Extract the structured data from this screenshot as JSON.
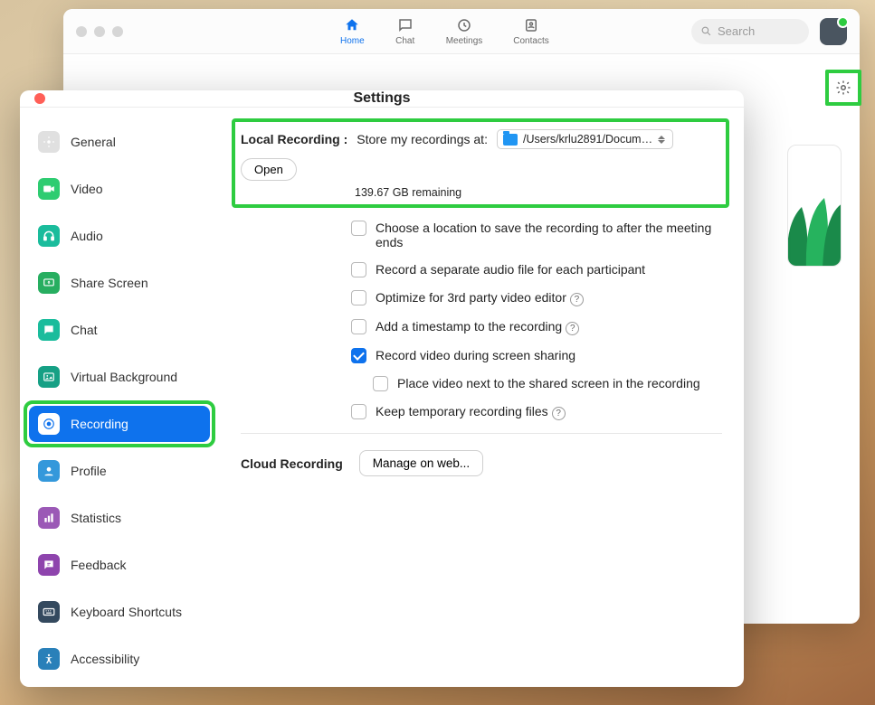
{
  "main": {
    "nav": {
      "home": "Home",
      "chat": "Chat",
      "meetings": "Meetings",
      "contacts": "Contacts"
    },
    "search_placeholder": "Search"
  },
  "settings": {
    "title": "Settings",
    "sidebar": [
      "General",
      "Video",
      "Audio",
      "Share Screen",
      "Chat",
      "Virtual Background",
      "Recording",
      "Profile",
      "Statistics",
      "Feedback",
      "Keyboard Shortcuts",
      "Accessibility"
    ],
    "local": {
      "label": "Local Recording :",
      "store_label": "Store my recordings at:",
      "path": "/Users/krlu2891/Docum…",
      "open": "Open",
      "remaining": "139.67 GB remaining"
    },
    "opts": {
      "o1": "Choose a location to save the recording to after the meeting ends",
      "o2": "Record a separate audio file for each participant",
      "o3": "Optimize for 3rd party video editor",
      "o4": "Add a timestamp to the recording",
      "o5": "Record video during screen sharing",
      "o5a": "Place video next to the shared screen in the recording",
      "o6": "Keep temporary recording files"
    },
    "cloud": {
      "label": "Cloud Recording",
      "manage": "Manage on web..."
    }
  }
}
